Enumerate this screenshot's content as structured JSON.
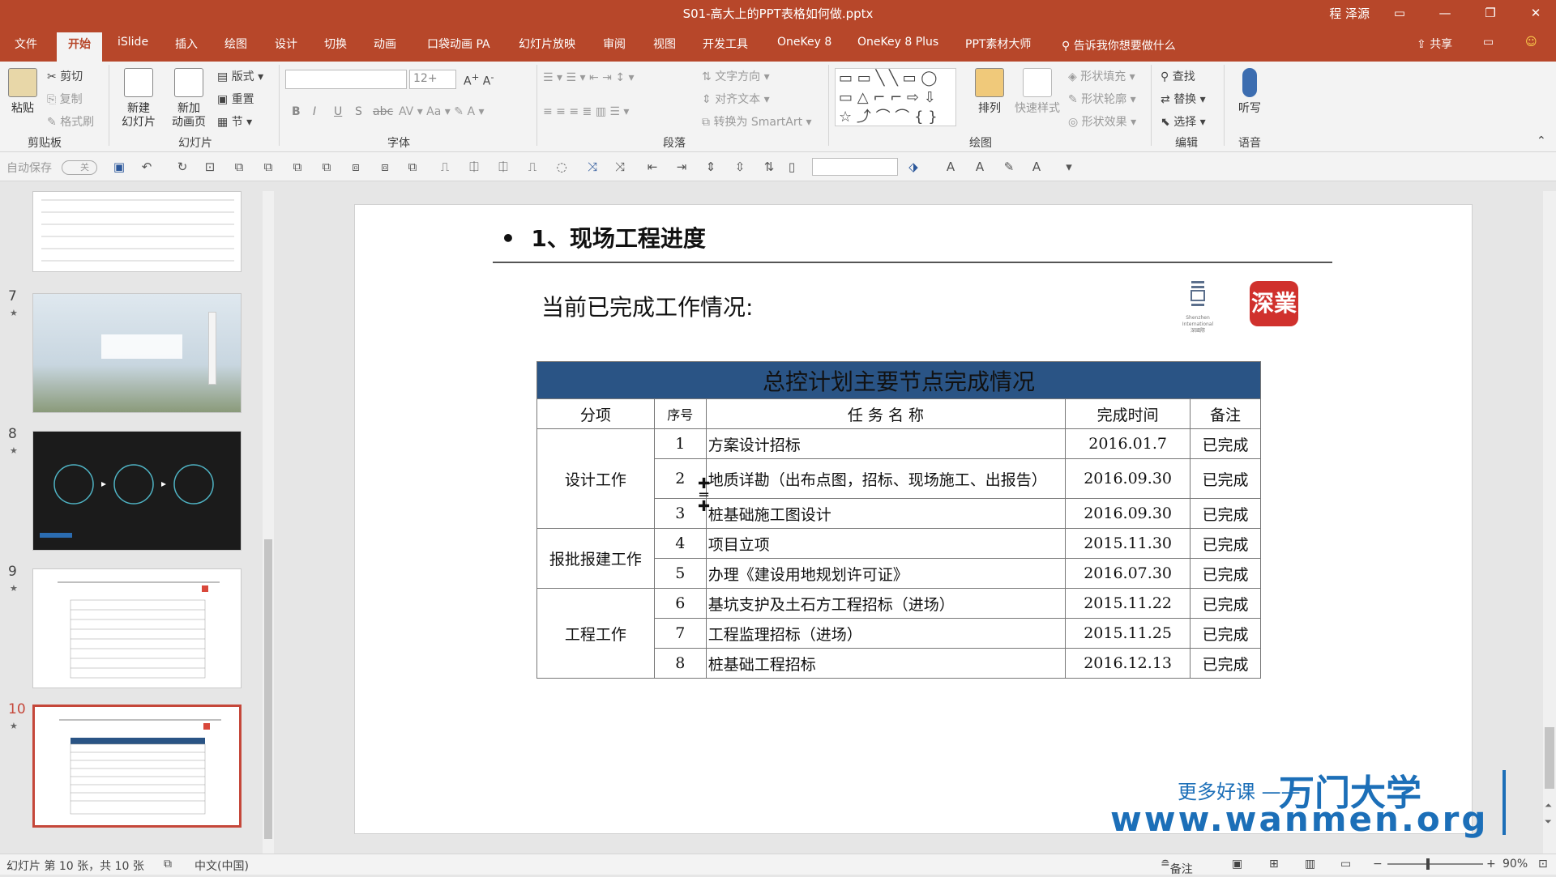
{
  "titlebar": {
    "title": "S01-高大上的PPT表格如何做.pptx",
    "user": "程 泽源"
  },
  "menu": [
    "文件",
    "开始",
    "iSlide",
    "插入",
    "绘图",
    "设计",
    "切换",
    "动画",
    "口袋动画 PA",
    "幻灯片放映",
    "审阅",
    "视图",
    "开发工具",
    "OneKey 8",
    "OneKey 8 Plus",
    "PPT素材大师"
  ],
  "menu_active": "开始",
  "search": "告诉我你想要做什么",
  "share": "共享",
  "ribbon": {
    "clipboard": {
      "paste": "粘贴",
      "cut": "剪切",
      "copy": "复制",
      "format": "格式刷",
      "group": "剪贴板"
    },
    "slides": {
      "new_slide": "新建\n幻灯片",
      "new_anim": "新加\n动画页",
      "layout": "版式",
      "reset": "重置",
      "section": "节",
      "group": "幻灯片"
    },
    "font": {
      "size": "12+",
      "group": "字体",
      "bold": "B",
      "italic": "I",
      "underline": "U",
      "shadow": "S",
      "strike": "abc"
    },
    "paragraph": {
      "text_dir": "文字方向",
      "align_text": "对齐文本",
      "smartart": "转换为 SmartArt",
      "group": "段落"
    },
    "drawing": {
      "arrange": "排列",
      "quick_style": "快速样式",
      "fill": "形状填充",
      "outline": "形状轮廓",
      "effect": "形状效果",
      "group": "绘图"
    },
    "editing": {
      "find": "查找",
      "replace": "替换",
      "select": "选择",
      "group": "编辑"
    },
    "voice": {
      "dictate": "听写",
      "group": "语音"
    }
  },
  "qat": {
    "autosave": "自动保存",
    "toggle": "关"
  },
  "thumbs": [
    {
      "num": "7"
    },
    {
      "num": "8"
    },
    {
      "num": "9"
    },
    {
      "num": "10"
    }
  ],
  "slide": {
    "heading": "1、现场工程进度",
    "subtitle": "当前已完成工作情况:",
    "seal": "深業",
    "logo_text": "Shenzhen International\n深國際",
    "table_title": "总控计划主要节点完成情况",
    "columns": [
      "分项",
      "序号",
      "任 务 名 称",
      "完成时间",
      "备注"
    ],
    "groups": [
      {
        "name": "设计工作",
        "rows": [
          {
            "n": "1",
            "task": "方案设计招标",
            "date": "2016.01.7",
            "note": "已完成"
          },
          {
            "n": "2",
            "task": "地质详勘（出布点图，招标、现场施工、出报告）",
            "date": "2016.09.30",
            "note": "已完成"
          },
          {
            "n": "3",
            "task": "桩基础施工图设计",
            "date": "2016.09.30",
            "note": "已完成"
          }
        ]
      },
      {
        "name": "报批报建工作",
        "rows": [
          {
            "n": "4",
            "task": "项目立项",
            "date": "2015.11.30",
            "note": "已完成"
          },
          {
            "n": "5",
            "task": "办理《建设用地规划许可证》",
            "date": "2016.07.30",
            "note": "已完成"
          }
        ]
      },
      {
        "name": "工程工作",
        "rows": [
          {
            "n": "6",
            "task": "基坑支护及土石方工程招标（进场）",
            "date": "2015.11.22",
            "note": "已完成"
          },
          {
            "n": "7",
            "task": "工程监理招标（进场）",
            "date": "2015.11.25",
            "note": "已完成"
          },
          {
            "n": "8",
            "task": "桩基础工程招标",
            "date": "2016.12.13",
            "note": "已完成"
          }
        ]
      }
    ],
    "watermark1": "更多好课 ——",
    "watermark2": "万门大学",
    "watermark3": "www.wanmen.org"
  },
  "status": {
    "slide_info": "幻灯片 第 10 张，共 10 张",
    "lang": "中文(中国)",
    "notes": "备注",
    "zoom": "90%"
  }
}
